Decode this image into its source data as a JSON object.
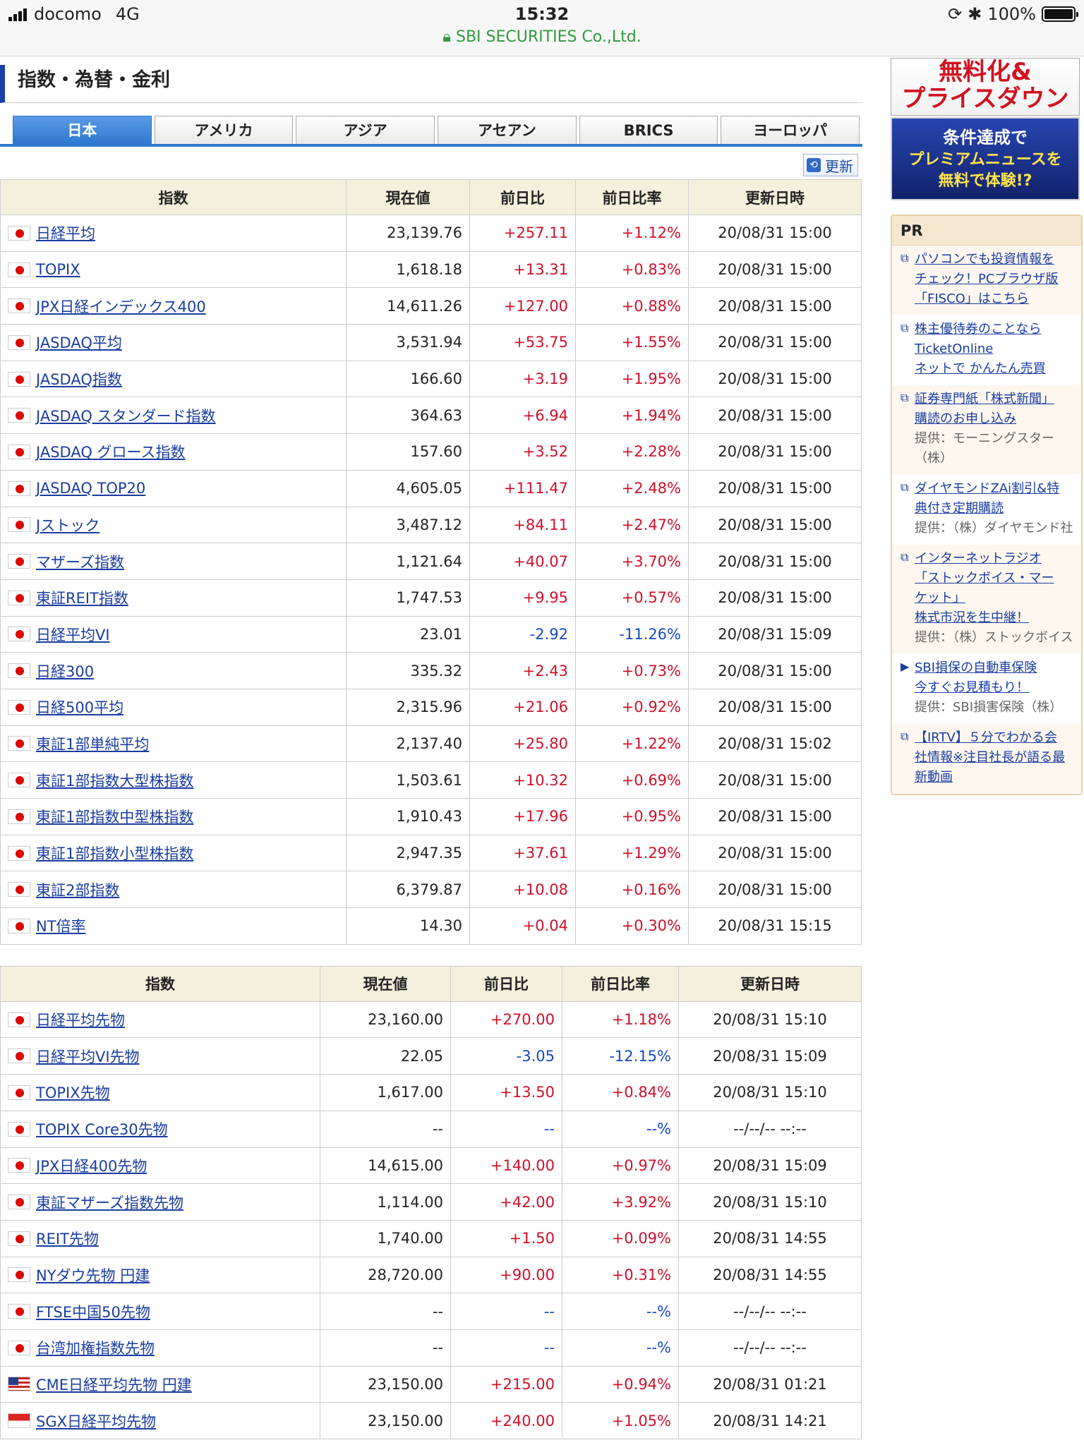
{
  "status_bar": {
    "carrier": "docomo",
    "network": "4G",
    "time": "15:32",
    "site": "SBI SECURITIES Co.,Ltd.",
    "battery": "100%"
  },
  "page": {
    "title": "指数・為替・金利",
    "refresh_label": "更新"
  },
  "tabs": [
    {
      "label": "日本"
    },
    {
      "label": "アメリカ"
    },
    {
      "label": "アジア"
    },
    {
      "label": "アセアン"
    },
    {
      "label": "BRICS"
    },
    {
      "label": "ヨーロッパ"
    }
  ],
  "headers": [
    "指数",
    "現在値",
    "前日比",
    "前日比率",
    "更新日時"
  ],
  "table1": [
    {
      "name": "日経平均",
      "price": "23,139.76",
      "change": "+257.11",
      "pct": "+1.12%",
      "time": "20/08/31 15:00",
      "flag": "jp"
    },
    {
      "name": "TOPIX",
      "price": "1,618.18",
      "change": "+13.31",
      "pct": "+0.83%",
      "time": "20/08/31 15:00",
      "flag": "jp"
    },
    {
      "name": "JPX日経インデックス400",
      "price": "14,611.26",
      "change": "+127.00",
      "pct": "+0.88%",
      "time": "20/08/31 15:00",
      "flag": "jp"
    },
    {
      "name": "JASDAQ平均",
      "price": "3,531.94",
      "change": "+53.75",
      "pct": "+1.55%",
      "time": "20/08/31 15:00",
      "flag": "jp"
    },
    {
      "name": "JASDAQ指数",
      "price": "166.60",
      "change": "+3.19",
      "pct": "+1.95%",
      "time": "20/08/31 15:00",
      "flag": "jp"
    },
    {
      "name": "JASDAQ スタンダード指数",
      "price": "364.63",
      "change": "+6.94",
      "pct": "+1.94%",
      "time": "20/08/31 15:00",
      "flag": "jp"
    },
    {
      "name": "JASDAQ グロース指数",
      "price": "157.60",
      "change": "+3.52",
      "pct": "+2.28%",
      "time": "20/08/31 15:00",
      "flag": "jp"
    },
    {
      "name": "JASDAQ TOP20",
      "price": "4,605.05",
      "change": "+111.47",
      "pct": "+2.48%",
      "time": "20/08/31 15:00",
      "flag": "jp"
    },
    {
      "name": "Jストック",
      "price": "3,487.12",
      "change": "+84.11",
      "pct": "+2.47%",
      "time": "20/08/31 15:00",
      "flag": "jp"
    },
    {
      "name": "マザーズ指数",
      "price": "1,121.64",
      "change": "+40.07",
      "pct": "+3.70%",
      "time": "20/08/31 15:00",
      "flag": "jp"
    },
    {
      "name": "東証REIT指数",
      "price": "1,747.53",
      "change": "+9.95",
      "pct": "+0.57%",
      "time": "20/08/31 15:00",
      "flag": "jp"
    },
    {
      "name": "日経平均VI",
      "price": "23.01",
      "change": "-2.92",
      "pct": "-11.26%",
      "time": "20/08/31 15:09",
      "flag": "jp"
    },
    {
      "name": "日経300",
      "price": "335.32",
      "change": "+2.43",
      "pct": "+0.73%",
      "time": "20/08/31 15:00",
      "flag": "jp"
    },
    {
      "name": "日経500平均",
      "price": "2,315.96",
      "change": "+21.06",
      "pct": "+0.92%",
      "time": "20/08/31 15:00",
      "flag": "jp"
    },
    {
      "name": "東証1部単純平均",
      "price": "2,137.40",
      "change": "+25.80",
      "pct": "+1.22%",
      "time": "20/08/31 15:02",
      "flag": "jp"
    },
    {
      "name": "東証1部指数大型株指数",
      "price": "1,503.61",
      "change": "+10.32",
      "pct": "+0.69%",
      "time": "20/08/31 15:00",
      "flag": "jp"
    },
    {
      "name": "東証1部指数中型株指数",
      "price": "1,910.43",
      "change": "+17.96",
      "pct": "+0.95%",
      "time": "20/08/31 15:00",
      "flag": "jp"
    },
    {
      "name": "東証1部指数小型株指数",
      "price": "2,947.35",
      "change": "+37.61",
      "pct": "+1.29%",
      "time": "20/08/31 15:00",
      "flag": "jp"
    },
    {
      "name": "東証2部指数",
      "price": "6,379.87",
      "change": "+10.08",
      "pct": "+0.16%",
      "time": "20/08/31 15:00",
      "flag": "jp"
    },
    {
      "name": "NT倍率",
      "price": "14.30",
      "change": "+0.04",
      "pct": "+0.30%",
      "time": "20/08/31 15:15",
      "flag": "jp"
    }
  ],
  "table2": [
    {
      "name": "日経平均先物",
      "price": "23,160.00",
      "change": "+270.00",
      "pct": "+1.18%",
      "time": "20/08/31 15:10",
      "flag": "jp"
    },
    {
      "name": "日経平均VI先物",
      "price": "22.05",
      "change": "-3.05",
      "pct": "-12.15%",
      "time": "20/08/31 15:09",
      "flag": "jp"
    },
    {
      "name": "TOPIX先物",
      "price": "1,617.00",
      "change": "+13.50",
      "pct": "+0.84%",
      "time": "20/08/31 15:10",
      "flag": "jp"
    },
    {
      "name": "TOPIX Core30先物",
      "price": "--",
      "change": "--",
      "pct": "--%",
      "time": "--/--/-- --:--",
      "flag": "jp"
    },
    {
      "name": "JPX日経400先物",
      "price": "14,615.00",
      "change": "+140.00",
      "pct": "+0.97%",
      "time": "20/08/31 15:09",
      "flag": "jp"
    },
    {
      "name": "東証マザーズ指数先物",
      "price": "1,114.00",
      "change": "+42.00",
      "pct": "+3.92%",
      "time": "20/08/31 15:10",
      "flag": "jp"
    },
    {
      "name": "REIT先物",
      "price": "1,740.00",
      "change": "+1.50",
      "pct": "+0.09%",
      "time": "20/08/31 14:55",
      "flag": "jp"
    },
    {
      "name": "NYダウ先物 円建",
      "price": "28,720.00",
      "change": "+90.00",
      "pct": "+0.31%",
      "time": "20/08/31 14:55",
      "flag": "jp"
    },
    {
      "name": "FTSE中国50先物",
      "price": "--",
      "change": "--",
      "pct": "--%",
      "time": "--/--/-- --:--",
      "flag": "jp"
    },
    {
      "name": "台湾加権指数先物",
      "price": "--",
      "change": "--",
      "pct": "--%",
      "time": "--/--/-- --:--",
      "flag": "jp"
    },
    {
      "name": "CME日経平均先物 円建",
      "price": "23,150.00",
      "change": "+215.00",
      "pct": "+0.94%",
      "time": "20/08/31 01:21",
      "flag": "us"
    },
    {
      "name": "SGX日経平均先物",
      "price": "23,150.00",
      "change": "+240.00",
      "pct": "+1.05%",
      "time": "20/08/31 14:21",
      "flag": "sg"
    }
  ],
  "sidebar": {
    "ad1": {
      "line1": "無料化&",
      "line2": "プライスダウン"
    },
    "ad2": {
      "line1": "条件達成で",
      "line2": "プレミアムニュースを",
      "line3": "無料で体験!?"
    },
    "pr_title": "PR",
    "pr_items": [
      {
        "links": [
          "パソコンでも投資情報を",
          "チェック！PCブラウザ版",
          "「FISCO」はこちら"
        ],
        "provider": ""
      },
      {
        "links": [
          "株主優待券のことなら",
          "TicketOnline",
          "ネットで かんたん売買"
        ],
        "provider": ""
      },
      {
        "links": [
          "証券専門紙「株式新聞」",
          "購読のお申し込み"
        ],
        "provider": "提供：モーニングスター（株）"
      },
      {
        "links": [
          "ダイヤモンドZAi割引&特",
          "典付き定期購読"
        ],
        "provider": "提供：（株）ダイヤモンド社"
      },
      {
        "links": [
          "インターネットラジオ",
          "「ストックボイス・マー",
          "ケット」",
          "株式市況を生中継！"
        ],
        "provider": "提供：（株）ストックボイス"
      },
      {
        "links": [
          "SBI損保の自動車保険",
          "今すぐお見積もり！"
        ],
        "provider": "提供：SBI損害保険（株）"
      },
      {
        "links": [
          "【IRTV】５分でわかる会",
          "社情報※注目社長が語る最",
          "新動画"
        ],
        "provider": ""
      }
    ]
  }
}
